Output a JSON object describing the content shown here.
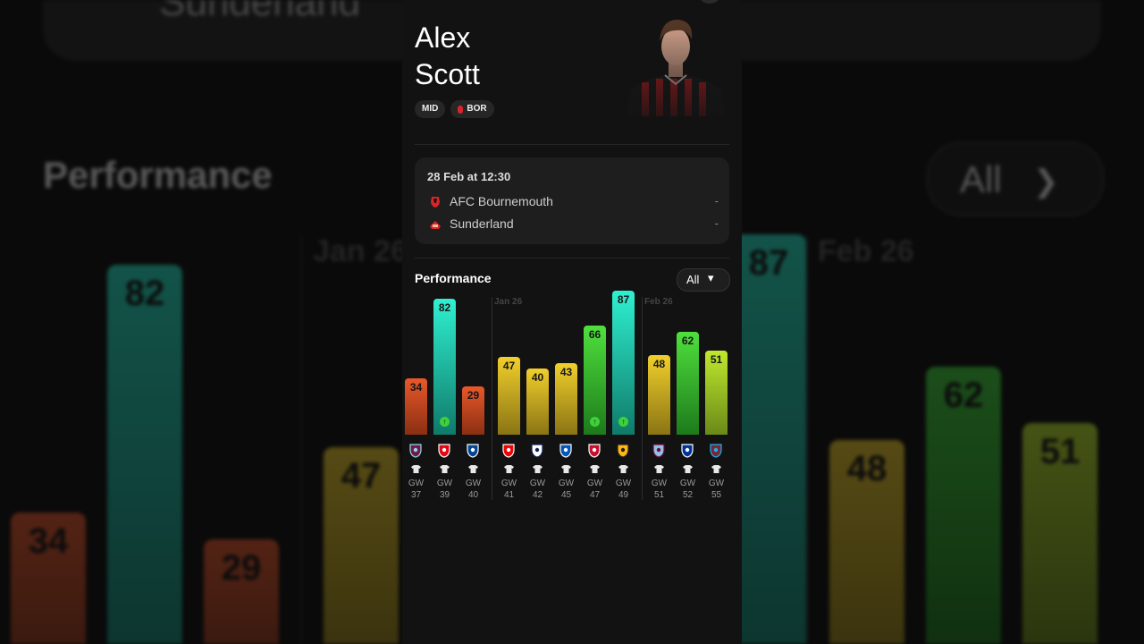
{
  "background": {
    "team_name": "Sunderland",
    "section_title": "Performance",
    "filter_label": "All",
    "months": [
      "Jan 26",
      "Feb 26"
    ],
    "bar_values": [
      34,
      82,
      29,
      47,
      87,
      48,
      62,
      51
    ]
  },
  "player": {
    "first_name": "Alex",
    "last_name": "Scott",
    "position": "MID",
    "team_code": "BOR"
  },
  "fixture": {
    "datetime": "28 Feb at 12:30",
    "home_team": "AFC Bournemouth",
    "home_score": "-",
    "away_team": "Sunderland",
    "away_score": "-"
  },
  "performance": {
    "title": "Performance",
    "filter_label": "All",
    "filter_icon": "chevron-down-icon"
  },
  "chart_data": {
    "type": "bar",
    "categories": [
      "GW 37",
      "GW 39",
      "GW 40",
      "GW 41",
      "GW 42",
      "GW 45",
      "GW 47",
      "GW 49",
      "GW 51",
      "GW 52",
      "GW 55"
    ],
    "values": [
      34,
      82,
      29,
      47,
      40,
      43,
      66,
      87,
      48,
      62,
      51
    ],
    "month_labels": [
      {
        "label": "Jan 26",
        "starts_at": "GW 41"
      },
      {
        "label": "Feb 26",
        "starts_at": "GW 51"
      }
    ],
    "opponents": [
      "Burnley",
      "Brentford",
      "Chelsea",
      "Arsenal",
      "Tottenham",
      "Brighton",
      "Liverpool",
      "Wolves",
      "Aston Villa",
      "Everton",
      "West Ham"
    ],
    "performance_icons": [
      null,
      "green",
      null,
      null,
      null,
      null,
      "green",
      "green",
      null,
      null,
      null
    ],
    "ylim": [
      0,
      100
    ],
    "colors": {
      "low": "#e0542a",
      "mid": "#e8c62a",
      "high": "#3fd13a",
      "top": "#25e0c2"
    }
  }
}
